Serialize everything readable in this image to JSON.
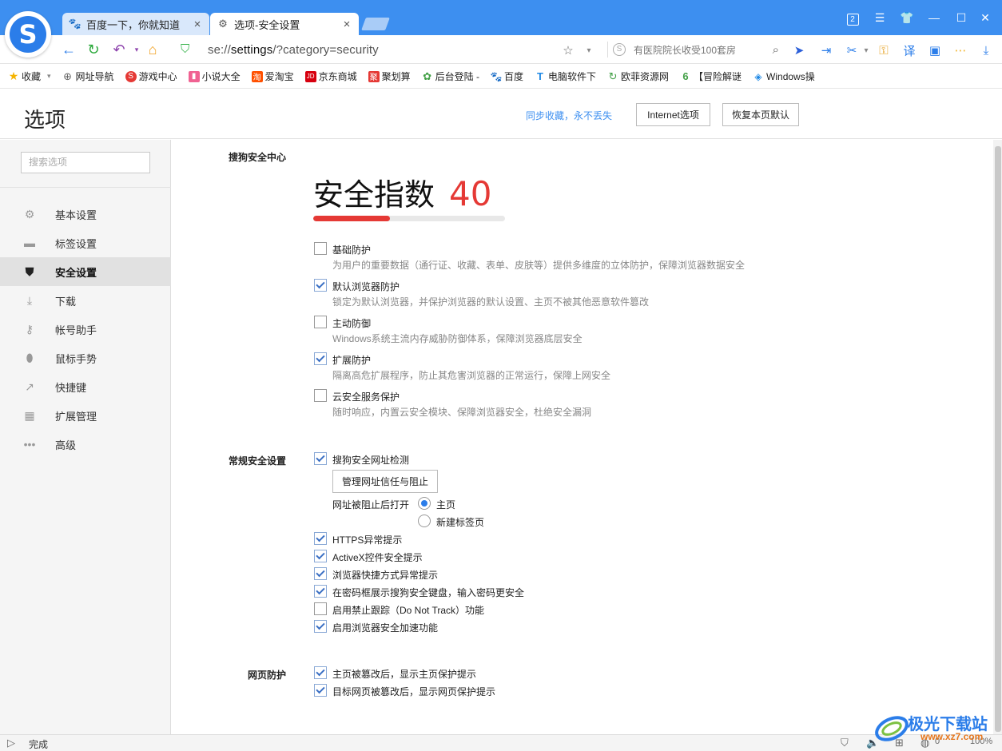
{
  "browser": {
    "logo_letter": "S",
    "tabs": [
      {
        "label": "百度一下，你就知道",
        "icon": "baidu-paw-icon"
      },
      {
        "label": "选项-安全设置",
        "icon": "gear-icon"
      }
    ],
    "window_controls": {
      "tab_count": "2"
    },
    "address": {
      "url_prefix": "se://",
      "url_host": "settings",
      "url_rest": "/?category=security"
    },
    "search": {
      "placeholder": "有医院院长收受100套房"
    },
    "bookmarks": [
      {
        "label": "收藏",
        "icon": "star-icon",
        "color": "#f5b400"
      },
      {
        "label": "网址导航",
        "icon": "globe-icon",
        "color": "#666666"
      },
      {
        "label": "游戏中心",
        "icon": "game-icon",
        "color": "#e53935"
      },
      {
        "label": "小说大全",
        "icon": "book-icon",
        "color": "#f06292"
      },
      {
        "label": "爱淘宝",
        "icon": "taobao-icon",
        "color": "#ff5000"
      },
      {
        "label": "京东商城",
        "icon": "jd-icon",
        "color": "#d7000f"
      },
      {
        "label": "聚划算",
        "icon": "juhuasuan-icon",
        "color": "#e53935"
      },
      {
        "label": "后台登陆 -",
        "icon": "leaf-icon",
        "color": "#43a047"
      },
      {
        "label": "百度",
        "icon": "baidu-paw-icon",
        "color": "#2b5fd9"
      },
      {
        "label": "电脑软件下",
        "icon": "software-icon",
        "color": "#1e88e5"
      },
      {
        "label": "欧菲资源网",
        "icon": "refresh-icon",
        "color": "#43a047"
      },
      {
        "label": "【冒险解谜",
        "icon": "six-icon",
        "color": "#43a047"
      },
      {
        "label": "Windows操",
        "icon": "windows-icon",
        "color": "#1e88e5"
      }
    ]
  },
  "page": {
    "title": "选项",
    "sync_link": "同步收藏，永不丢失",
    "internet_options": "Internet选项",
    "restore_default": "恢复本页默认"
  },
  "sidebar": {
    "search_placeholder": "搜索选项",
    "items": [
      {
        "label": "基本设置",
        "icon": "gear-icon"
      },
      {
        "label": "标签设置",
        "icon": "laptop-icon"
      },
      {
        "label": "安全设置",
        "icon": "shield-icon"
      },
      {
        "label": "下载",
        "icon": "download-icon"
      },
      {
        "label": "帐号助手",
        "icon": "key-icon"
      },
      {
        "label": "鼠标手势",
        "icon": "mouse-icon"
      },
      {
        "label": "快捷键",
        "icon": "shortcut-arrow-icon"
      },
      {
        "label": "扩展管理",
        "icon": "grid-icon"
      },
      {
        "label": "高级",
        "icon": "more-dots-icon"
      }
    ],
    "active_index": 2
  },
  "security": {
    "center_label": "搜狗安全中心",
    "score_text": "安全指数",
    "score_value": "40",
    "score_fraction": 0.4,
    "protections": [
      {
        "label": "基础防护",
        "desc": "为用户的重要数据（通行证、收藏、表单、皮肤等）提供多维度的立体防护，保障浏览器数据安全",
        "checked": false
      },
      {
        "label": "默认浏览器防护",
        "desc": "锁定为默认浏览器，并保护浏览器的默认设置、主页不被其他恶意软件篡改",
        "checked": true
      },
      {
        "label": "主动防御",
        "desc": "Windows系统主流内存威胁防御体系，保障浏览器底层安全",
        "checked": false
      },
      {
        "label": "扩展防护",
        "desc": "隔离高危扩展程序，防止其危害浏览器的正常运行，保障上网安全",
        "checked": true
      },
      {
        "label": "云安全服务保护",
        "desc": "随时响应，内置云安全模块、保障浏览器安全，杜绝安全漏洞",
        "checked": false
      }
    ],
    "general_label": "常规安全设置",
    "url_check": {
      "label": "搜狗安全网址检测",
      "checked": true
    },
    "manage_button": "管理网址信任与阻止",
    "blocked_open_label": "网址被阻止后打开",
    "blocked_options": [
      {
        "label": "主页",
        "selected": true
      },
      {
        "label": "新建标签页",
        "selected": false
      }
    ],
    "general_options": [
      {
        "label": "HTTPS异常提示",
        "checked": true
      },
      {
        "label": "ActiveX控件安全提示",
        "checked": true
      },
      {
        "label": "浏览器快捷方式异常提示",
        "checked": true
      },
      {
        "label": "在密码框展示搜狗安全键盘，输入密码更安全",
        "checked": true
      },
      {
        "label": "启用禁止跟踪（Do Not Track）功能",
        "checked": false
      },
      {
        "label": "启用浏览器安全加速功能",
        "checked": true
      }
    ],
    "web_label": "网页防护",
    "web_options": [
      {
        "label": "主页被篡改后，显示主页保护提示",
        "checked": true
      },
      {
        "label": "目标网页被篡改后，显示网页保护提示",
        "checked": true
      }
    ]
  },
  "statusbar": {
    "status": "完成",
    "zoom": "100%",
    "count": "0"
  },
  "watermark": {
    "title": "极光下载站",
    "url": "www.xz7.com"
  },
  "colors": {
    "accent": "#3d8ff0",
    "score_red": "#e53935",
    "link_blue": "#3d8ff0"
  }
}
